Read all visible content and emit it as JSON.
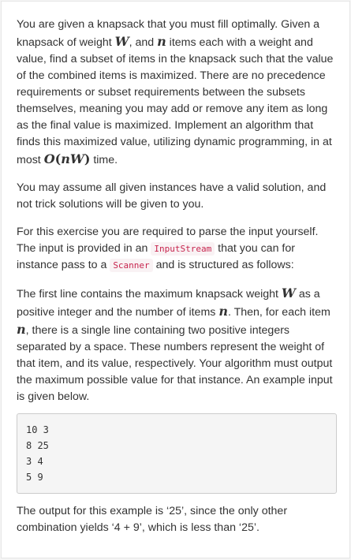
{
  "problem": {
    "p1": {
      "t1": "You are given a knapsack that you must fill optimally. Given a knapsack of weight ",
      "W": "W",
      "t2": ", and ",
      "n": "n",
      "t3": " items each with a weight and value, find a subset of items in the knapsack such that the value of the combined items is maximized. There are no precedence requirements or subset requirements between the subsets themselves, meaning you may add or remove any item as long as the final value is maximized. Implement an algorithm that finds this maximized value, utilizing dynamic programming, in at most ",
      "complexity_O": "O",
      "complexity_open": "(",
      "complexity_n": "n",
      "complexity_W": "W",
      "complexity_close": ")",
      "t4": " time."
    },
    "p2": "You may assume all given instances have a valid solution, and not trick solutions will be given to you.",
    "p3": {
      "t1": "For this exercise you are required to parse the input yourself. The input is provided in an ",
      "code1": "InputStream",
      "t2": " that you can for instance pass to a ",
      "code2": "Scanner",
      "t3": " and is structured as follows:"
    },
    "p4": {
      "t1": "The first line contains the maximum knapsack weight ",
      "W": "W",
      "t2": " as a positive integer and the number of items ",
      "n1": "n",
      "t3": ". Then, for each item ",
      "n2": "n",
      "t4": ", there is a single line containing two positive integers separated by a space. These numbers represent the weight of that item, and its value, respectively. Your algorithm must output the maximum possible value for that instance. An example input is given below."
    },
    "example_input": [
      "10 3",
      "8 25",
      "3 4",
      "5 9"
    ],
    "p5": "The output for this example is ‘25’, since the only other combination yields ‘4 + 9’, which is less than ‘25’."
  }
}
